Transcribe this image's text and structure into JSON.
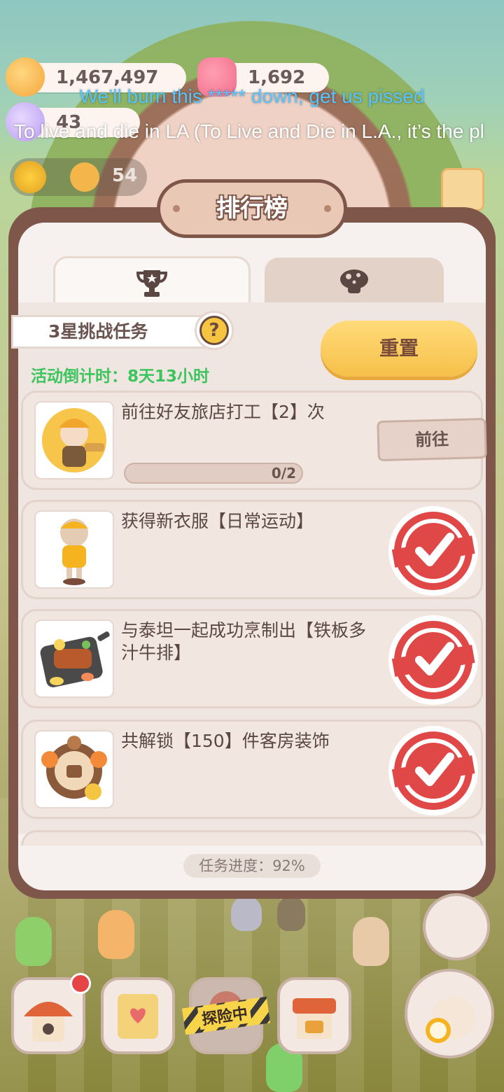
{
  "resources": {
    "coins": "1,467,497",
    "gems": "1,692",
    "candy": "43",
    "level_count": "54"
  },
  "lyrics": {
    "line1": "We’ll burn this ***** down, get us pissed",
    "line2": "To live and die in LA (To Live and Die in L.A., it’s the pl"
  },
  "panel": {
    "title": "排行榜",
    "tabs": [
      {
        "icon": "trophy-icon",
        "active": true
      },
      {
        "icon": "mushroom-icon",
        "active": false
      }
    ],
    "subtitle": "3星挑战任务",
    "help_label": "?",
    "countdown": "活动倒计时：8天13小时",
    "reset_label": "重置",
    "tasks": [
      {
        "title": "前往好友旅店打工【2】次",
        "progress": "0/2",
        "action": "前往",
        "done": false,
        "thumb": "worker-character"
      },
      {
        "title": "获得新衣服【日常运动】",
        "done": true,
        "thumb": "sport-outfit"
      },
      {
        "title": "与泰坦一起成功烹制出【铁板多汁牛排】",
        "done": true,
        "thumb": "sizzling-steak"
      },
      {
        "title": "共解锁【150】件客房装饰",
        "done": true,
        "thumb": "room-decoration"
      }
    ],
    "footer_progress": "任务进度：92%"
  },
  "bottom_nav": {
    "explore_label": "探险中"
  },
  "colors": {
    "panel_border": "#7e564a",
    "countdown_green": "#3cc45d",
    "reset_yellow": "#f6c049",
    "stamp_red": "#e04848",
    "lyric_blue": "#55c4ff"
  }
}
